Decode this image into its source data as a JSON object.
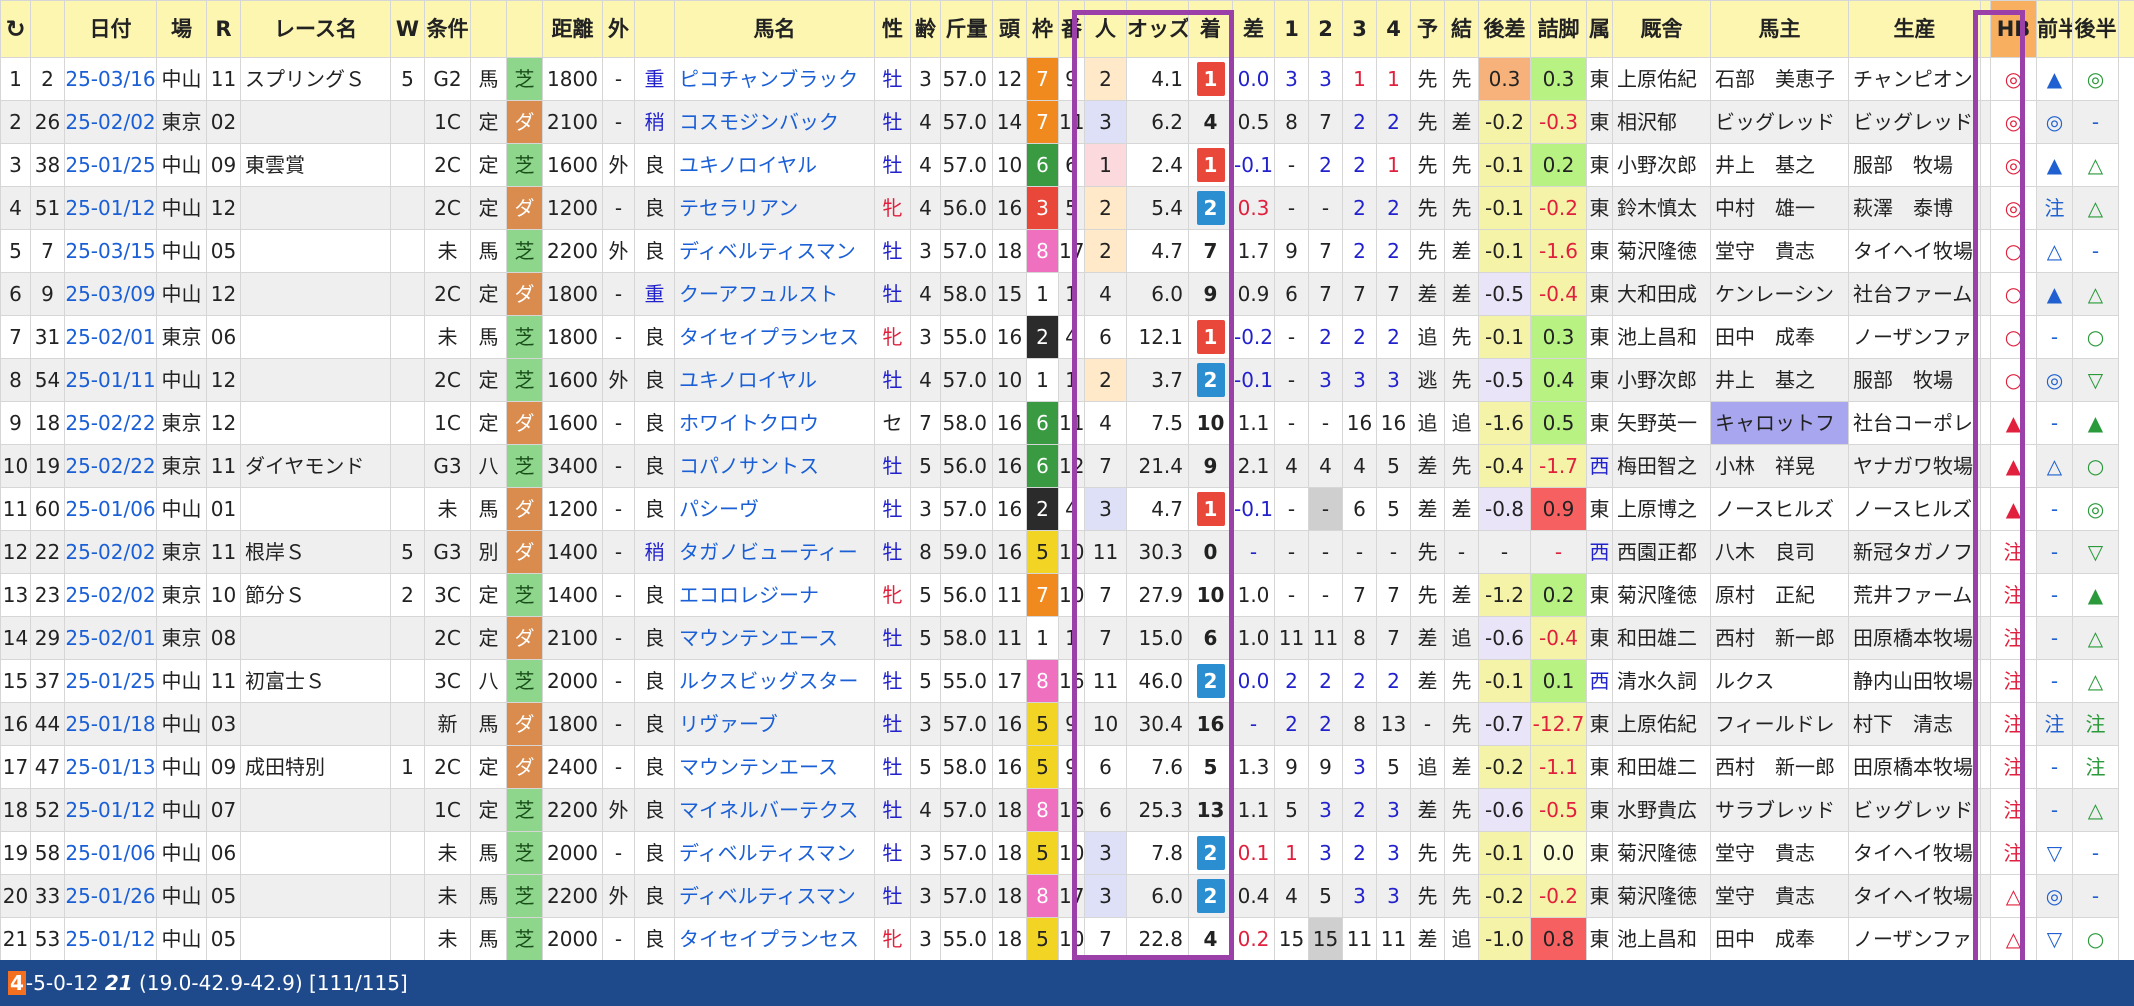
{
  "headers": [
    "",
    "",
    "日付",
    "場",
    "R",
    "レース名",
    "W",
    "条件",
    "",
    "",
    "距離",
    "外",
    "",
    "馬名",
    "性",
    "齢",
    "斤量",
    "頭",
    "枠",
    "番",
    "人",
    "オッズ",
    "着",
    "差",
    "1",
    "2",
    "3",
    "4",
    "予",
    "結",
    "後差",
    "詰脚",
    "属",
    "厩舎",
    "馬主",
    "生産",
    "",
    "HB",
    "前半",
    "後半",
    ""
  ],
  "rows": [
    [
      "1",
      "2",
      "25-03/16",
      "中山",
      "11",
      "スプリングＳ",
      "5",
      "G2",
      "馬",
      "芝",
      "1800",
      "-",
      "重",
      "ピコチャンブラック",
      "牡",
      "3",
      "57.0",
      "12",
      "7",
      "9",
      "2",
      "4.1",
      "1",
      "0.0",
      "3",
      "3",
      "1",
      "1",
      "先",
      "先",
      "0.3",
      "0.3",
      "東",
      "上原佑紀",
      "石部　美恵子",
      "チャンピオン",
      "",
      "◎",
      "▲",
      "◎"
    ],
    [
      "2",
      "26",
      "25-02/02",
      "東京",
      "02",
      "",
      "",
      "1C",
      "定",
      "ダ",
      "2100",
      "-",
      "稍",
      "コスモジンバック",
      "牡",
      "4",
      "57.0",
      "14",
      "7",
      "11",
      "3",
      "6.2",
      "4",
      "0.5",
      "8",
      "7",
      "2",
      "2",
      "先",
      "差",
      "-0.2",
      "-0.3",
      "東",
      "相沢郁",
      "ビッグレッド",
      "ビッグレッド",
      "",
      "◎",
      "◎",
      "-"
    ],
    [
      "3",
      "38",
      "25-01/25",
      "中山",
      "09",
      "東雲賞",
      "",
      "2C",
      "定",
      "芝",
      "1600",
      "外",
      "良",
      "ユキノロイヤル",
      "牡",
      "4",
      "57.0",
      "10",
      "6",
      "6",
      "1",
      "2.4",
      "1",
      "-0.1",
      "-",
      "2",
      "2",
      "1",
      "先",
      "先",
      "-0.1",
      "0.2",
      "東",
      "小野次郎",
      "井上　基之",
      "服部　牧場",
      "",
      "◎",
      "▲",
      "△"
    ],
    [
      "4",
      "51",
      "25-01/12",
      "中山",
      "12",
      "",
      "",
      "2C",
      "定",
      "ダ",
      "1200",
      "-",
      "良",
      "テセラリアン",
      "牝",
      "4",
      "56.0",
      "16",
      "3",
      "5",
      "2",
      "5.4",
      "2",
      "0.3",
      "-",
      "-",
      "2",
      "2",
      "先",
      "先",
      "-0.1",
      "-0.2",
      "東",
      "鈴木慎太",
      "中村　雄一",
      "萩澤　泰博",
      "",
      "◎",
      "注",
      "△"
    ],
    [
      "5",
      "7",
      "25-03/15",
      "中山",
      "05",
      "",
      "",
      "未",
      "馬",
      "芝",
      "2200",
      "外",
      "良",
      "ディベルティスマン",
      "牡",
      "3",
      "57.0",
      "18",
      "8",
      "17",
      "2",
      "4.7",
      "7",
      "1.7",
      "9",
      "7",
      "2",
      "2",
      "先",
      "差",
      "-0.1",
      "-1.6",
      "東",
      "菊沢隆徳",
      "堂守　貴志",
      "タイヘイ牧場",
      "",
      "○",
      "△",
      "-"
    ],
    [
      "6",
      "9",
      "25-03/09",
      "中山",
      "12",
      "",
      "",
      "2C",
      "定",
      "ダ",
      "1800",
      "-",
      "重",
      "クーアフュルスト",
      "牡",
      "4",
      "58.0",
      "15",
      "1",
      "1",
      "4",
      "6.0",
      "9",
      "0.9",
      "6",
      "7",
      "7",
      "7",
      "差",
      "差",
      "-0.5",
      "-0.4",
      "東",
      "大和田成",
      "ケンレーシン",
      "社台ファーム",
      "",
      "○",
      "▲",
      "△"
    ],
    [
      "7",
      "31",
      "25-02/01",
      "東京",
      "06",
      "",
      "",
      "未",
      "馬",
      "芝",
      "1800",
      "-",
      "良",
      "タイセイプランセス",
      "牝",
      "3",
      "55.0",
      "16",
      "2",
      "4",
      "6",
      "12.1",
      "1",
      "-0.2",
      "-",
      "2",
      "2",
      "2",
      "追",
      "先",
      "-0.1",
      "0.3",
      "東",
      "池上昌和",
      "田中　成奉",
      "ノーザンファ",
      "",
      "○",
      "-",
      "○"
    ],
    [
      "8",
      "54",
      "25-01/11",
      "中山",
      "12",
      "",
      "",
      "2C",
      "定",
      "芝",
      "1600",
      "外",
      "良",
      "ユキノロイヤル",
      "牡",
      "4",
      "57.0",
      "10",
      "1",
      "1",
      "2",
      "3.7",
      "2",
      "-0.1",
      "-",
      "3",
      "3",
      "3",
      "逃",
      "先",
      "-0.5",
      "0.4",
      "東",
      "小野次郎",
      "井上　基之",
      "服部　牧場",
      "",
      "○",
      "◎",
      "▽"
    ],
    [
      "9",
      "18",
      "25-02/22",
      "東京",
      "12",
      "",
      "",
      "1C",
      "定",
      "ダ",
      "1600",
      "-",
      "良",
      "ホワイトクロウ",
      "セ",
      "7",
      "58.0",
      "16",
      "6",
      "11",
      "4",
      "7.5",
      "10",
      "1.1",
      "-",
      "-",
      "16",
      "16",
      "追",
      "追",
      "-1.6",
      "0.5",
      "東",
      "矢野英一",
      "キャロットフ",
      "社台コーポレ",
      "",
      "▲",
      "-",
      "▲"
    ],
    [
      "10",
      "19",
      "25-02/22",
      "東京",
      "11",
      "ダイヤモンド",
      "",
      "G3",
      "八",
      "芝",
      "3400",
      "-",
      "良",
      "コパノサントス",
      "牡",
      "5",
      "56.0",
      "16",
      "6",
      "12",
      "7",
      "21.4",
      "9",
      "2.1",
      "4",
      "4",
      "4",
      "5",
      "差",
      "先",
      "-0.4",
      "-1.7",
      "西",
      "梅田智之",
      "小林　祥晃",
      "ヤナガワ牧場",
      "",
      "▲",
      "△",
      "○"
    ],
    [
      "11",
      "60",
      "25-01/06",
      "中山",
      "01",
      "",
      "",
      "未",
      "馬",
      "ダ",
      "1200",
      "-",
      "良",
      "パシーヴ",
      "牡",
      "3",
      "57.0",
      "16",
      "2",
      "4",
      "3",
      "4.7",
      "1",
      "-0.1",
      "-",
      "-",
      "6",
      "5",
      "差",
      "差",
      "-0.8",
      "0.9",
      "東",
      "上原博之",
      "ノースヒルズ",
      "ノースヒルズ",
      "",
      "▲",
      "-",
      "◎"
    ],
    [
      "12",
      "22",
      "25-02/02",
      "東京",
      "11",
      "根岸Ｓ",
      "5",
      "G3",
      "別",
      "ダ",
      "1400",
      "-",
      "稍",
      "タガノビューティー",
      "牡",
      "8",
      "59.0",
      "16",
      "5",
      "10",
      "11",
      "30.3",
      "0",
      "-",
      "-",
      "-",
      "-",
      "-",
      "先",
      "-",
      "-",
      "-",
      "西",
      "西園正都",
      "八木　良司",
      "新冠タガノフ",
      "",
      "注",
      "-",
      "▽"
    ],
    [
      "13",
      "23",
      "25-02/02",
      "東京",
      "10",
      "節分Ｓ",
      "2",
      "3C",
      "定",
      "芝",
      "1400",
      "-",
      "良",
      "エコロレジーナ",
      "牝",
      "5",
      "56.0",
      "11",
      "7",
      "10",
      "7",
      "27.9",
      "10",
      "1.0",
      "-",
      "-",
      "7",
      "7",
      "先",
      "差",
      "-1.2",
      "0.2",
      "東",
      "菊沢隆徳",
      "原村　正紀",
      "荒井ファーム",
      "",
      "注",
      "-",
      "▲"
    ],
    [
      "14",
      "29",
      "25-02/01",
      "東京",
      "08",
      "",
      "",
      "2C",
      "定",
      "ダ",
      "2100",
      "-",
      "良",
      "マウンテンエース",
      "牡",
      "5",
      "58.0",
      "11",
      "1",
      "1",
      "7",
      "15.0",
      "6",
      "1.0",
      "11",
      "11",
      "8",
      "7",
      "差",
      "追",
      "-0.6",
      "-0.4",
      "東",
      "和田雄二",
      "西村　新一郎",
      "田原橋本牧場",
      "",
      "注",
      "-",
      "△"
    ],
    [
      "15",
      "37",
      "25-01/25",
      "中山",
      "11",
      "初富士Ｓ",
      "",
      "3C",
      "八",
      "芝",
      "2000",
      "-",
      "良",
      "ルクスビッグスター",
      "牡",
      "5",
      "55.0",
      "17",
      "8",
      "16",
      "11",
      "46.0",
      "2",
      "0.0",
      "2",
      "2",
      "2",
      "2",
      "差",
      "先",
      "-0.1",
      "0.1",
      "西",
      "清水久詞",
      "ルクス",
      "静内山田牧場",
      "",
      "注",
      "-",
      "△"
    ],
    [
      "16",
      "44",
      "25-01/18",
      "中山",
      "03",
      "",
      "",
      "新",
      "馬",
      "ダ",
      "1800",
      "-",
      "良",
      "リヴァーブ",
      "牡",
      "3",
      "57.0",
      "16",
      "5",
      "9",
      "10",
      "30.4",
      "16",
      "-",
      "2",
      "2",
      "8",
      "13",
      "-",
      "先",
      "-0.7",
      "-12.7",
      "東",
      "上原佑紀",
      "フィールドレ",
      "村下　清志",
      "",
      "注",
      "注",
      "注"
    ],
    [
      "17",
      "47",
      "25-01/13",
      "中山",
      "09",
      "成田特別",
      "1",
      "2C",
      "定",
      "ダ",
      "2400",
      "-",
      "良",
      "マウンテンエース",
      "牡",
      "5",
      "58.0",
      "16",
      "5",
      "9",
      "6",
      "7.6",
      "5",
      "1.3",
      "9",
      "9",
      "3",
      "5",
      "追",
      "差",
      "-0.2",
      "-1.1",
      "東",
      "和田雄二",
      "西村　新一郎",
      "田原橋本牧場",
      "",
      "注",
      "-",
      "注"
    ],
    [
      "18",
      "52",
      "25-01/12",
      "中山",
      "07",
      "",
      "",
      "1C",
      "定",
      "芝",
      "2200",
      "外",
      "良",
      "マイネルバーテクス",
      "牡",
      "4",
      "57.0",
      "18",
      "8",
      "16",
      "6",
      "25.3",
      "13",
      "1.1",
      "5",
      "3",
      "2",
      "3",
      "差",
      "先",
      "-0.6",
      "-0.5",
      "東",
      "水野貴広",
      "サラブレッド",
      "ビッグレッド",
      "",
      "注",
      "-",
      "△"
    ],
    [
      "19",
      "58",
      "25-01/06",
      "中山",
      "06",
      "",
      "",
      "未",
      "馬",
      "芝",
      "2000",
      "-",
      "良",
      "ディベルティスマン",
      "牡",
      "3",
      "57.0",
      "18",
      "5",
      "10",
      "3",
      "7.8",
      "2",
      "0.1",
      "1",
      "3",
      "2",
      "3",
      "先",
      "先",
      "-0.1",
      "0.0",
      "東",
      "菊沢隆徳",
      "堂守　貴志",
      "タイヘイ牧場",
      "",
      "注",
      "▽",
      "-"
    ],
    [
      "20",
      "33",
      "25-01/26",
      "中山",
      "05",
      "",
      "",
      "未",
      "馬",
      "芝",
      "2200",
      "外",
      "良",
      "ディベルティスマン",
      "牡",
      "3",
      "57.0",
      "18",
      "8",
      "17",
      "3",
      "6.0",
      "2",
      "0.4",
      "4",
      "5",
      "3",
      "3",
      "先",
      "先",
      "-0.2",
      "-0.2",
      "東",
      "菊沢隆徳",
      "堂守　貴志",
      "タイヘイ牧場",
      "",
      "△",
      "◎",
      "-"
    ],
    [
      "21",
      "53",
      "25-01/12",
      "中山",
      "05",
      "",
      "",
      "未",
      "馬",
      "芝",
      "2000",
      "-",
      "良",
      "タイセイプランセス",
      "牝",
      "3",
      "55.0",
      "18",
      "5",
      "10",
      "7",
      "22.8",
      "4",
      "0.2",
      "15",
      "15",
      "11",
      "11",
      "差",
      "追",
      "-1.0",
      "0.8",
      "東",
      "池上昌和",
      "田中　成奉",
      "ノーザンファ",
      "",
      "△",
      "▽",
      "○"
    ]
  ],
  "footer": {
    "highlight": "4",
    "record": "-5-0-12",
    "count": "21",
    "stats": "(19.0-42.9-42.9) [111/115]"
  }
}
